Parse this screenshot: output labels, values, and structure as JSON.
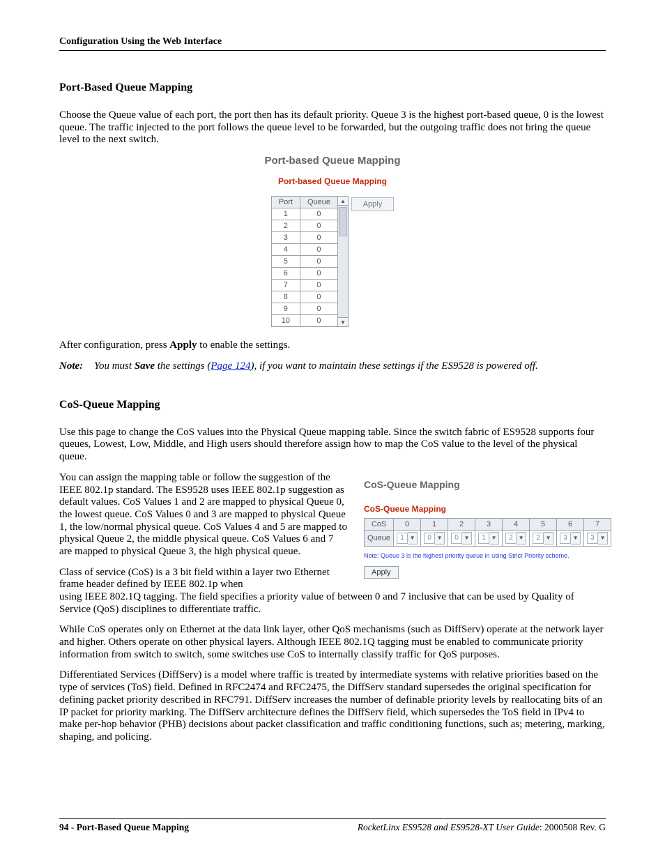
{
  "header": {
    "running_head": "Configuration Using the Web Interface"
  },
  "section1": {
    "title": "Port-Based Queue Mapping",
    "intro": "Choose the Queue value of each port, the port then has its default priority. Queue 3 is the highest port-based queue, 0 is the lowest queue. The traffic injected to the port follows the queue level to be forwarded, but the outgoing traffic does not bring the queue level to the next switch.",
    "fig_title": "Port-based Queue Mapping",
    "fig_legend": "Port-based Queue Mapping",
    "table_headers": {
      "port": "Port",
      "queue": "Queue"
    },
    "rows": [
      {
        "port": "1",
        "queue": "0"
      },
      {
        "port": "2",
        "queue": "0"
      },
      {
        "port": "3",
        "queue": "0"
      },
      {
        "port": "4",
        "queue": "0"
      },
      {
        "port": "5",
        "queue": "0"
      },
      {
        "port": "6",
        "queue": "0"
      },
      {
        "port": "7",
        "queue": "0"
      },
      {
        "port": "8",
        "queue": "0"
      },
      {
        "port": "9",
        "queue": "0"
      },
      {
        "port": "10",
        "queue": "0"
      }
    ],
    "apply_label": "Apply",
    "after_text_pre": "After configuration, press ",
    "after_text_apply": "Apply",
    "after_text_post": " to enable the settings.",
    "note_label": "Note:",
    "note_pre": "You must ",
    "note_save": "Save",
    "note_mid": " the settings (",
    "note_link": "Page 124",
    "note_post": "), if you want to maintain these settings if the ES9528 is powered off."
  },
  "section2": {
    "title": "CoS-Queue Mapping",
    "intro": "Use this page to change the CoS values into the Physical Queue mapping table. Since the switch fabric of ES9528 supports four queues, Lowest, Low, Middle, and High users should therefore assign how to map the CoS value to the level of the physical queue.",
    "left_p1": "You can assign the mapping table or follow the suggestion of the IEEE 802.1p standard. The ES9528 uses IEEE 802.1p suggestion as default values. CoS Values 1 and 2 are mapped to physical Queue 0, the lowest queue. CoS Values 0 and 3 are mapped to physical Queue 1, the low/normal physical queue. CoS Values 4 and 5 are mapped to physical Queue 2, the middle physical queue. CoS Values 6 and 7 are mapped to physical Queue 3, the high physical queue.",
    "left_p2": "Class of service (CoS) is a 3 bit field within a layer two Ethernet frame header defined by IEEE 802.1p when",
    "fig_title": "CoS-Queue Mapping",
    "fig_legend": "CoS-Queue Mapping",
    "row_labels": {
      "cos": "CoS",
      "queue": "Queue"
    },
    "cos_values": [
      "0",
      "1",
      "2",
      "3",
      "4",
      "5",
      "6",
      "7"
    ],
    "queue_values": [
      "1",
      "0",
      "0",
      "1",
      "2",
      "2",
      "3",
      "3"
    ],
    "fig_note": "Note: Queue 3 is the highest priority queue in using Strict Priority scheme.",
    "apply_label": "Apply",
    "full_p1": "using IEEE 802.1Q tagging. The field specifies a priority value of between 0 and 7 inclusive that can be used by Quality of Service (QoS) disciplines to differentiate traffic.",
    "full_p2": "While CoS operates only on Ethernet at the data link layer, other QoS mechanisms (such as DiffServ) operate at the network layer and higher. Others operate on other physical layers. Although IEEE 802.1Q tagging must be enabled to communicate priority information from switch to switch, some switches use CoS to internally classify traffic for QoS purposes.",
    "full_p3": "Differentiated Services (DiffServ) is a model where traffic is treated by intermediate systems with relative priorities based on the type of services (ToS) field. Defined in RFC2474 and RFC2475, the DiffServ standard supersedes the original specification for defining packet priority described in RFC791. DiffServ increases the number of definable priority levels by reallocating bits of an IP packet for priority marking. The DiffServ architecture defines the DiffServ field, which supersedes the ToS field in IPv4 to make per-hop behavior (PHB) decisions about packet classification and traffic conditioning functions, such as; metering, marking, shaping, and policing."
  },
  "footer": {
    "page_num": "94",
    "page_title": "Port-Based Queue Mapping",
    "guide": "RocketLinx ES9528 and ES9528-XT User Guide",
    "rev": ": 2000508 Rev. G"
  }
}
